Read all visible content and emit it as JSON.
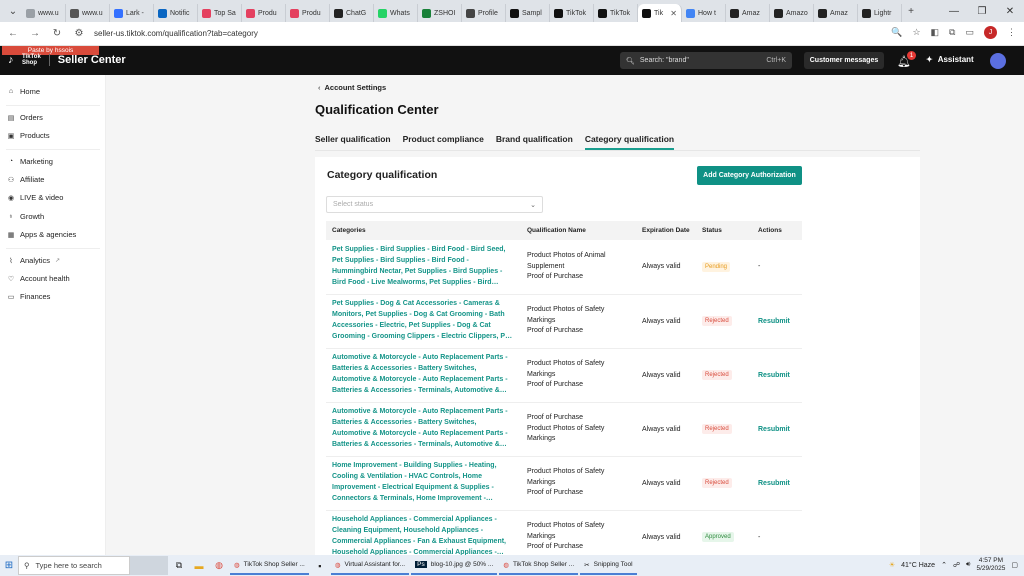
{
  "browser": {
    "tabs": [
      {
        "label": "www.u",
        "color": "#9aa0a6"
      },
      {
        "label": "www.u",
        "color": "#555555"
      },
      {
        "label": "Lark -",
        "color": "#3370ff"
      },
      {
        "label": "Notific",
        "color": "#0a66c2"
      },
      {
        "label": "Top Sa",
        "color": "#e4405f"
      },
      {
        "label": "Produ",
        "color": "#e4405f"
      },
      {
        "label": "Produ",
        "color": "#e4405f"
      },
      {
        "label": "ChatG",
        "color": "#222222"
      },
      {
        "label": "Whats",
        "color": "#25d366"
      },
      {
        "label": "ZSHOI",
        "color": "#188038"
      },
      {
        "label": "Profile",
        "color": "#444444"
      },
      {
        "label": "Sampl",
        "color": "#111111"
      },
      {
        "label": "TikTok",
        "color": "#111111"
      },
      {
        "label": "TikTok",
        "color": "#111111"
      },
      {
        "label": "Tik",
        "color": "#111111"
      },
      {
        "label": "How t",
        "color": "#4285f4"
      },
      {
        "label": "Amaz",
        "color": "#222222"
      },
      {
        "label": "Amazo",
        "color": "#222222"
      },
      {
        "label": "Amaz",
        "color": "#222222"
      },
      {
        "label": "Lightr",
        "color": "#222222"
      }
    ],
    "url": "seller-us.tiktok.com/qualification?tab=category",
    "profile_initial": "J"
  },
  "header": {
    "paste_tip": "Paste by hssois",
    "logo_line1": "TikTok",
    "logo_line2": "Shop",
    "title": "Seller Center",
    "search_placeholder": "Search: \"brand\"",
    "search_shortcut": "Ctrl+K",
    "customer_messages": "Customer messages",
    "notif_count": "1",
    "assistant": "Assistant"
  },
  "sidebar": {
    "items": [
      {
        "label": "Home",
        "icon": "home-icon"
      },
      {
        "label": "Orders",
        "icon": "orders-icon"
      },
      {
        "label": "Products",
        "icon": "products-icon"
      },
      {
        "label": "Marketing",
        "icon": "marketing-icon"
      },
      {
        "label": "Affiliate",
        "icon": "affiliate-icon"
      },
      {
        "label": "LIVE & video",
        "icon": "live-icon"
      },
      {
        "label": "Growth",
        "icon": "growth-icon"
      },
      {
        "label": "Apps & agencies",
        "icon": "apps-icon"
      },
      {
        "label": "Analytics",
        "icon": "analytics-icon"
      },
      {
        "label": "Account health",
        "icon": "account-health-icon"
      },
      {
        "label": "Finances",
        "icon": "finances-icon"
      }
    ]
  },
  "main": {
    "breadcrumb": "Account Settings",
    "title": "Qualification Center",
    "tabs": [
      "Seller qualification",
      "Product compliance",
      "Brand qualification",
      "Category qualification"
    ],
    "card_title": "Category qualification",
    "add_button": "Add Category Authorization",
    "select_placeholder": "Select status",
    "table": {
      "headers": [
        "Categories",
        "Qualification Name",
        "Expiration Date",
        "Status",
        "Actions"
      ],
      "rows": [
        {
          "category": "Pet Supplies - Bird Supplies - Bird Food - Bird Seed, Pet Supplies - Bird Supplies - Bird Food - Hummingbird Nectar, Pet Supplies - Bird Supplies - Bird Food - Live Mealworms, Pet Supplies - Bird Supplies - Bird Food - Suet, Pet Su...",
          "qualification": "Product Photos of Animal Supplement\nProof of Purchase",
          "expiration": "Always valid",
          "status": "Pending",
          "status_type": "pending",
          "action": "-"
        },
        {
          "category": "Pet Supplies - Dog & Cat Accessories - Cameras & Monitors, Pet Supplies - Dog & Cat Grooming - Bath Accessories - Electric, Pet Supplies - Dog & Cat Grooming - Grooming Clippers - Electric Clippers, Pet Supplies - Dog & Cat Gr...",
          "qualification": "Product Photos of Safety Markings\nProof of Purchase",
          "expiration": "Always valid",
          "status": "Rejected",
          "status_type": "rejected",
          "action": "Resubmit"
        },
        {
          "category": "Automotive & Motorcycle - Auto Replacement Parts - Batteries & Accessories - Battery Switches, Automotive & Motorcycle - Auto Replacement Parts - Batteries & Accessories - Terminals, Automotive & Motorcycle - Auto Replace...",
          "qualification": "Product Photos of Safety Markings\nProof of Purchase",
          "expiration": "Always valid",
          "status": "Rejected",
          "status_type": "rejected",
          "action": "Resubmit"
        },
        {
          "category": "Automotive & Motorcycle - Auto Replacement Parts - Batteries & Accessories - Battery Switches, Automotive & Motorcycle - Auto Replacement Parts - Batteries & Accessories - Terminals, Automotive & Motorcycle - Auto Replace...",
          "qualification": "Proof of Purchase\nProduct Photos of Safety Markings",
          "expiration": "Always valid",
          "status": "Rejected",
          "status_type": "rejected",
          "action": "Resubmit"
        },
        {
          "category": "Home Improvement - Building Supplies - Heating, Cooling & Ventilation - HVAC Controls, Home Improvement - Electrical Equipment & Supplies - Connectors & Terminals, Home Improvement - Electrical Equipment & Supplies - Mo...",
          "qualification": "Product Photos of Safety Markings\nProof of Purchase",
          "expiration": "Always valid",
          "status": "Rejected",
          "status_type": "rejected",
          "action": "Resubmit"
        },
        {
          "category": "Household Appliances - Commercial Appliances - Cleaning Equipment, Household Appliances - Commercial Appliances - Fan & Exhaust Equipment, Household Appliances - Commercial Appliances - Food Processing Equipment, H...",
          "qualification": "Product Photos of Safety Markings\nProof of Purchase",
          "expiration": "Always valid",
          "status": "Approved",
          "status_type": "approved",
          "action": "-"
        }
      ]
    }
  },
  "taskbar": {
    "search_placeholder": "Type here to search",
    "apps": [
      "TikTok Shop Seller ...",
      "Virtual Assistant for...",
      "blog-10.jpg @ 50% ...",
      "TikTok Shop Seller ...",
      "Snipping Tool"
    ],
    "weather": "41°C  Haze",
    "time": "4:57 PM",
    "date": "5/29/2025"
  }
}
